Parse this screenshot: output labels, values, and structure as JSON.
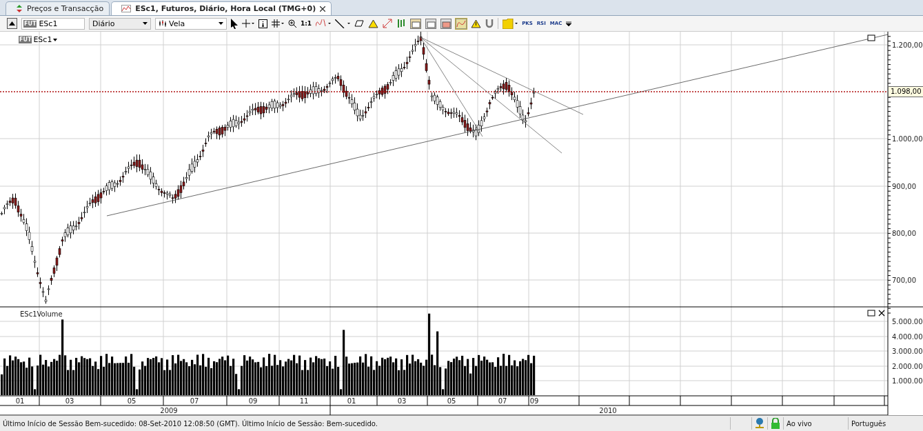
{
  "tabs": [
    {
      "label": "Preços e Transacção",
      "selected": false,
      "closable": false
    },
    {
      "label": "ESc1, Futuros, Diário, Hora Local (TMG+0)",
      "selected": true,
      "closable": true
    }
  ],
  "toolbar": {
    "symbol": "ESc1",
    "symbol_badge": "FUT",
    "period": "Diário",
    "chart_type": "Vela",
    "scale_button": "1:1",
    "indicators": [
      "PKS",
      "RSI",
      "MAC"
    ]
  },
  "chart": {
    "legend": "ESc1",
    "legend_badge": "FUT",
    "price_axis": [
      "1.200,00",
      "1.000,00",
      "900,00",
      "800,00",
      "700,00"
    ],
    "current_price": "1.098,00",
    "volume_label": "ESc1Volume",
    "volume_axis": [
      "5.000.00",
      "4.000.00",
      "3.000.00",
      "2.000.00",
      "1.000.00"
    ],
    "months": [
      "01",
      "03",
      "05",
      "07",
      "09",
      "11",
      "01",
      "03",
      "05",
      "07",
      "09"
    ],
    "years": [
      "2009",
      "2010"
    ]
  },
  "status_bar": {
    "message": "Último Início de Sessão Bem-sucedido: 08-Set-2010 12:08:50 (GMT). Último Início de Sessão: Bem-sucedido.",
    "mode": "Ao vivo",
    "language": "Português"
  }
}
